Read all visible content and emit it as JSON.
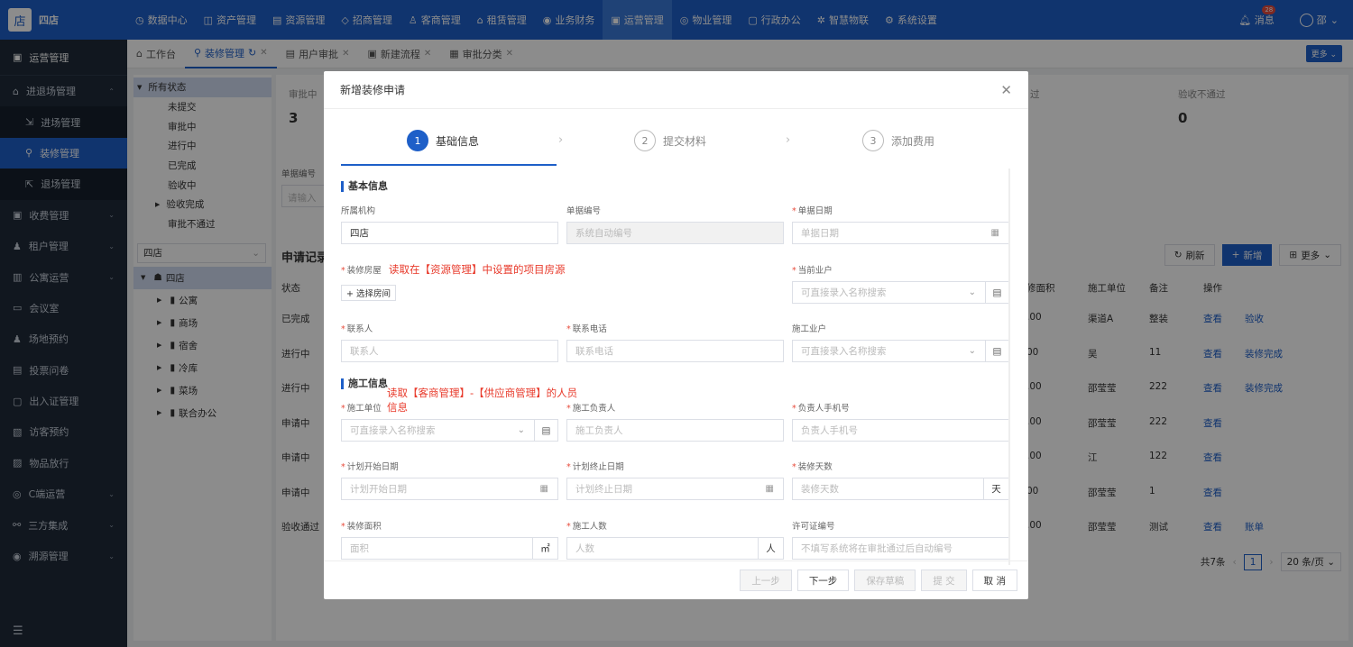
{
  "app": {
    "logo": "店",
    "store": "四店"
  },
  "topnav": [
    {
      "icon": "◷",
      "label": "数据中心"
    },
    {
      "icon": "◫",
      "label": "资产管理"
    },
    {
      "icon": "▤",
      "label": "资源管理"
    },
    {
      "icon": "◇",
      "label": "招商管理"
    },
    {
      "icon": "♙",
      "label": "客商管理"
    },
    {
      "icon": "⌂",
      "label": "租赁管理"
    },
    {
      "icon": "◉",
      "label": "业务财务"
    },
    {
      "icon": "▣",
      "label": "运营管理"
    },
    {
      "icon": "◎",
      "label": "物业管理"
    },
    {
      "icon": "▢",
      "label": "行政办公"
    },
    {
      "icon": "✲",
      "label": "智慧物联"
    },
    {
      "icon": "⚙",
      "label": "系统设置"
    }
  ],
  "header": {
    "messages": "消息",
    "msg_count": "28",
    "user": "邵"
  },
  "sidebar": {
    "title": "运营管理",
    "items": [
      {
        "label": "进退场管理",
        "icon": "⌂",
        "arrow": "⌃"
      },
      {
        "label": "进场管理",
        "icon": "⇲",
        "sub": true
      },
      {
        "label": "装修管理",
        "icon": "⚲",
        "sub": true,
        "active": true
      },
      {
        "label": "退场管理",
        "icon": "⇱",
        "sub": true
      },
      {
        "label": "收费管理",
        "icon": "▣",
        "arrow": "⌄"
      },
      {
        "label": "租户管理",
        "icon": "♟",
        "arrow": "⌄"
      },
      {
        "label": "公寓运营",
        "icon": "▥",
        "arrow": "⌄"
      },
      {
        "label": "会议室",
        "icon": "▭"
      },
      {
        "label": "场地预约",
        "icon": "♟"
      },
      {
        "label": "投票问卷",
        "icon": "▤"
      },
      {
        "label": "出入证管理",
        "icon": "▢"
      },
      {
        "label": "访客预约",
        "icon": "▧"
      },
      {
        "label": "物品放行",
        "icon": "▨"
      },
      {
        "label": "C端运营",
        "icon": "◎",
        "arrow": "⌄"
      },
      {
        "label": "三方集成",
        "icon": "⚯",
        "arrow": "⌄"
      },
      {
        "label": "溯源管理",
        "icon": "◉",
        "arrow": "⌄"
      }
    ],
    "bottom_icon": "☰"
  },
  "tabs": [
    {
      "label": "工作台",
      "icon": "⌂"
    },
    {
      "label": "装修管理",
      "icon": "⚲",
      "active": true,
      "refresh": "↻"
    },
    {
      "label": "用户审批",
      "icon": "▤"
    },
    {
      "label": "新建流程",
      "icon": "▣"
    },
    {
      "label": "审批分类",
      "icon": "▦"
    }
  ],
  "tab_more": "更多 ⌄",
  "tree": {
    "statuses": [
      "所有状态",
      "未提交",
      "审批中",
      "进行中",
      "已完成",
      "验收中",
      "验收完成",
      "审批不通过"
    ],
    "store_select": "四店",
    "nodes": [
      "四店",
      "公寓",
      "商场",
      "宿舍",
      "冷库",
      "菜场",
      "联合办公"
    ]
  },
  "stats": [
    {
      "label": "审批中",
      "value": "3"
    },
    {
      "label": "过",
      "value": ""
    },
    {
      "label": "验收不通过",
      "value": "0"
    }
  ],
  "list": {
    "title": "申请记录",
    "bill_no_label": "单据编号",
    "bill_no_placeholder": "请输入",
    "refresh": "刷新",
    "add": "新增",
    "more": "更多",
    "headers": [
      "状态",
      "修面积",
      "施工单位",
      "备注",
      "操作"
    ],
    "rows": [
      {
        "status": "已完成",
        "area": ".00",
        "unit": "渠道A",
        "note": "整装",
        "ops": [
          "查看",
          "验收"
        ]
      },
      {
        "status": "进行中",
        "area": "00",
        "unit": "吴",
        "note": "11",
        "ops": [
          "查看",
          "装修完成"
        ]
      },
      {
        "status": "进行中",
        "area": ".00",
        "unit": "邵莹莹",
        "note": "222",
        "ops": [
          "查看",
          "装修完成"
        ]
      },
      {
        "status": "申请中",
        "area": ".00",
        "unit": "邵莹莹",
        "note": "222",
        "ops": [
          "查看"
        ]
      },
      {
        "status": "申请中",
        "area": ".00",
        "unit": "江",
        "note": "122",
        "ops": [
          "查看"
        ]
      },
      {
        "status": "申请中",
        "area": "00",
        "unit": "邵莹莹",
        "note": "1",
        "ops": [
          "查看"
        ]
      },
      {
        "status": "验收通过",
        "area": ".00",
        "unit": "邵莹莹",
        "note": "测试",
        "ops": [
          "查看",
          "账单"
        ]
      }
    ],
    "total": "共7条",
    "page": "1",
    "page_size": "20 条/页"
  },
  "modal": {
    "title": "新增装修申请",
    "steps": [
      {
        "num": "1",
        "label": "基础信息"
      },
      {
        "num": "2",
        "label": "提交材料"
      },
      {
        "num": "3",
        "label": "添加费用"
      }
    ],
    "sec_basic": "基本信息",
    "sec_build": "施工信息",
    "org_label": "所属机构",
    "org_value": "四店",
    "billno_label": "单据编号",
    "billno_placeholder": "系统自动编号",
    "date_label": "单据日期",
    "date_placeholder": "单据日期",
    "room_label": "装修房屋",
    "room_btn": "+ 选择房间",
    "room_note": "读取在【资源管理】中设置的项目房源",
    "owner_label": "当前业户",
    "owner_placeholder": "可直接录入名称搜索",
    "contact_label": "联系人",
    "contact_placeholder": "联系人",
    "phone_label": "联系电话",
    "phone_placeholder": "联系电话",
    "builder_owner_label": "施工业户",
    "builder_owner_placeholder": "可直接录入名称搜索",
    "unit_label": "施工单位",
    "unit_placeholder": "可直接录入名称搜索",
    "unit_note": "读取【客商管理】-【供应商管理】的人员信息",
    "leader_label": "施工负责人",
    "leader_placeholder": "施工负责人",
    "leader_phone_label": "负责人手机号",
    "leader_phone_placeholder": "负责人手机号",
    "start_label": "计划开始日期",
    "start_placeholder": "计划开始日期",
    "end_label": "计划终止日期",
    "end_placeholder": "计划终止日期",
    "days_label": "装修天数",
    "days_placeholder": "装修天数",
    "days_unit": "天",
    "area_label": "装修面积",
    "area_placeholder": "面积",
    "area_unit": "㎡",
    "workers_label": "施工人数",
    "workers_placeholder": "人数",
    "workers_unit": "人",
    "permit_label": "许可证编号",
    "permit_placeholder": "不填写系统将在审批通过后自动编号",
    "buttons": {
      "prev": "上一步",
      "next": "下一步",
      "draft": "保存草稿",
      "submit": "提 交",
      "cancel": "取 消"
    }
  }
}
